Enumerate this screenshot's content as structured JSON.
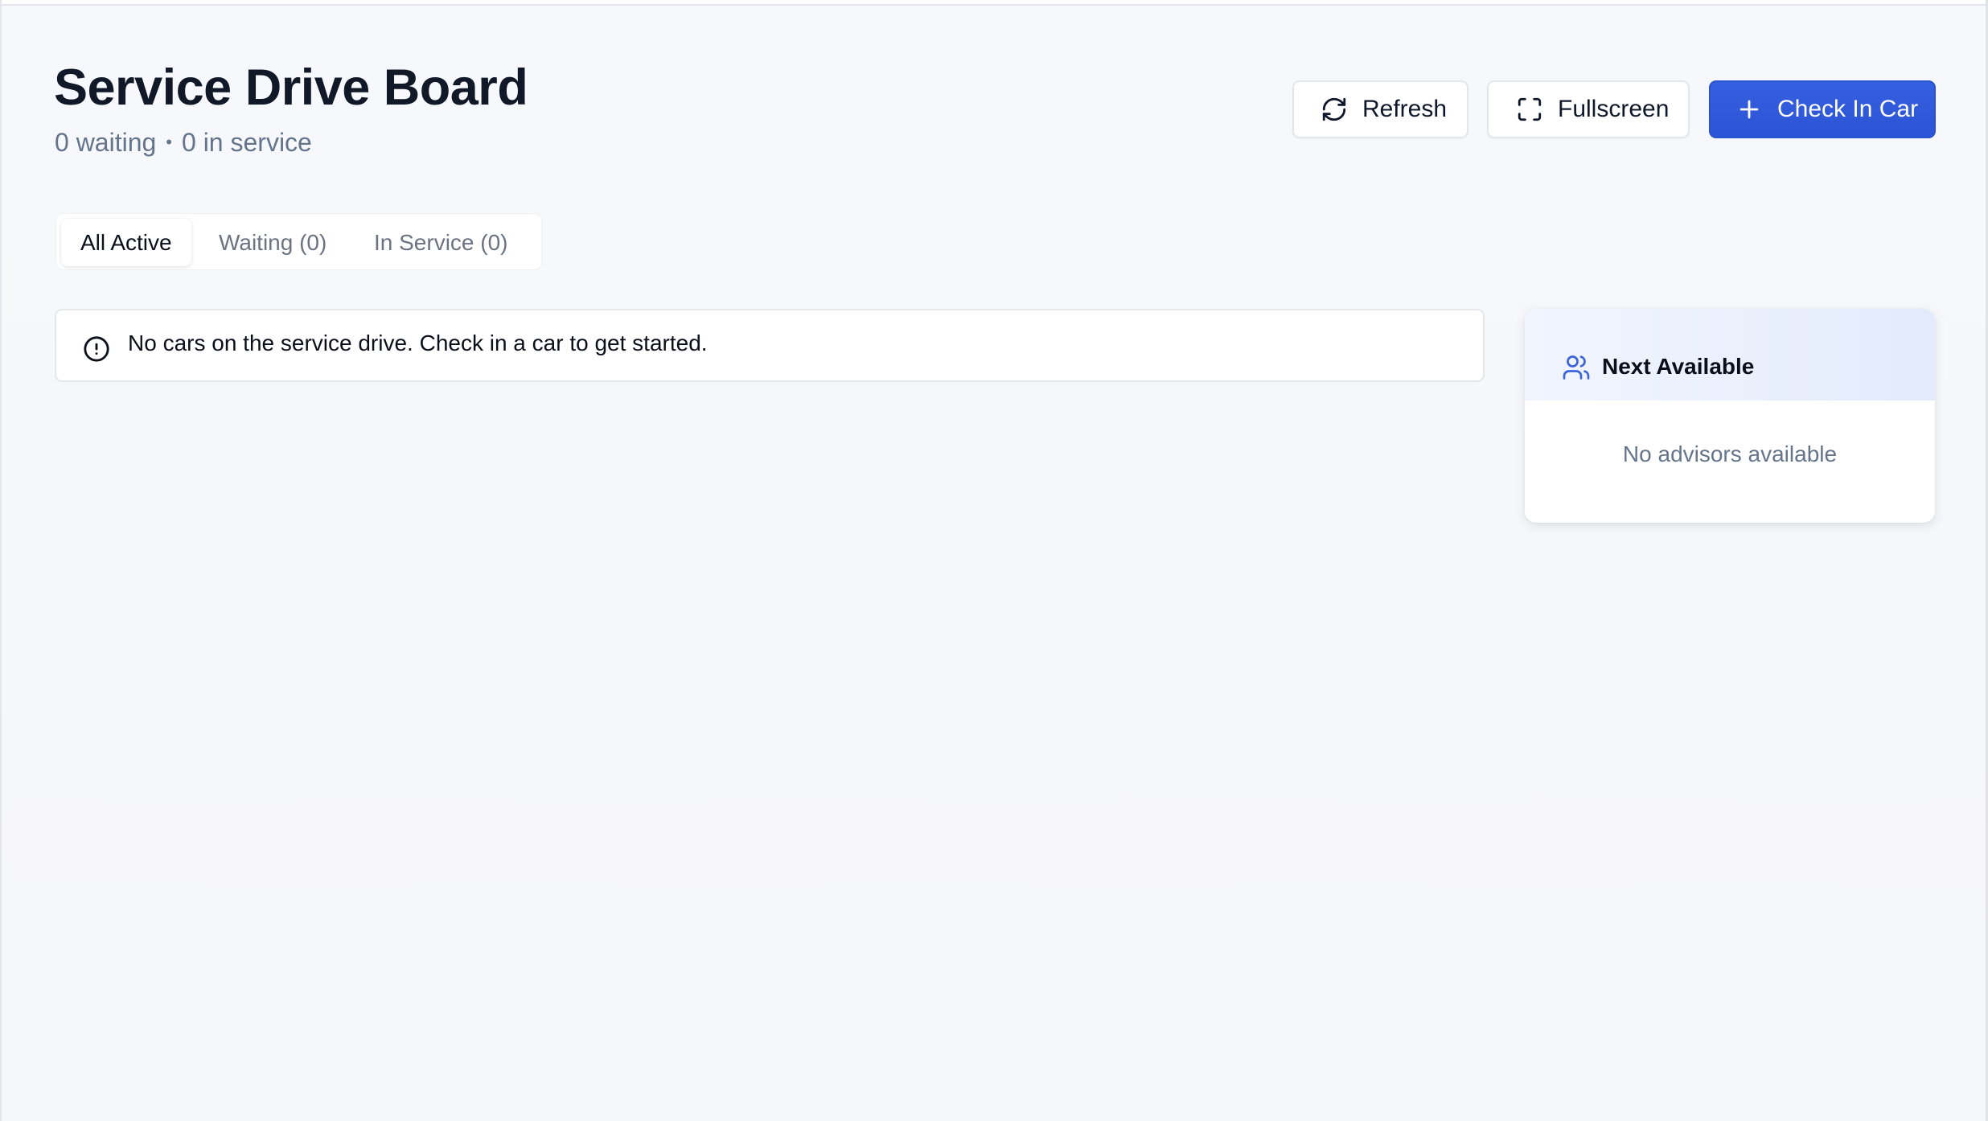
{
  "header": {
    "title": "Service Drive Board",
    "waiting_summary": "0 waiting",
    "separator": "•",
    "service_summary": "0 in service"
  },
  "toolbar": {
    "refresh_label": "Refresh",
    "fullscreen_label": "Fullscreen",
    "checkin_label": "Check In Car"
  },
  "tabs": [
    {
      "label": "All Active",
      "active": true
    },
    {
      "label": "Waiting (0)",
      "active": false
    },
    {
      "label": "In Service (0)",
      "active": false
    }
  ],
  "empty_state": {
    "message": "No cars on the service drive. Check in a car to get started.",
    "icon": "alert-circle-icon"
  },
  "next_available": {
    "title": "Next Available",
    "icon": "users-icon",
    "empty_message": "No advisors available"
  },
  "colors": {
    "primary": "#2f57d9",
    "title": "#111827",
    "muted": "#64748b",
    "background": "#f6f7fa",
    "accent_icon": "#3b63dc"
  },
  "icons": {
    "refresh": "refresh-icon",
    "fullscreen": "fullscreen-icon",
    "checkin": "plus-icon"
  }
}
